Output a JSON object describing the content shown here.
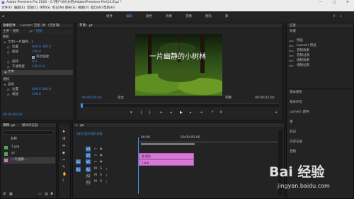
{
  "window": {
    "title": "Adobe Premiere Pro 2020 - C:\\用户\\XX\\文档\\Adobe\\Premiere Pro\\14.0\\yz *",
    "controls": [
      "—",
      "□",
      "✕"
    ]
  },
  "menu": [
    "文件(F)",
    "编辑(E)",
    "剪辑(C)",
    "序列(S)",
    "标记(M)",
    "图形(G)",
    "视图(V)",
    "窗口(W)",
    "帮助(H)"
  ],
  "workspace": {
    "tabs": [
      "组件",
      "编辑",
      "颜色",
      "效果",
      "音频",
      "图形",
      "库"
    ],
    "active": "编辑"
  },
  "effect_controls": {
    "tabs": [
      "效果控件",
      "Lumetri 范围",
      "源：(无剪辑)",
      "音频剪辑混合器"
    ],
    "clip_row": [
      "主要 * 图形",
      "yz * 图形"
    ],
    "sections": [
      {
        "label": "图形",
        "level": 0
      },
      {
        "label": "文本(一片幽静…)",
        "level": 1
      },
      {
        "label": "位置",
        "value": "640.0  360.0",
        "level": 2
      },
      {
        "label": "缩放",
        "value": "100.0",
        "level": 2
      },
      {
        "label": "",
        "checkbox": "等比缩放",
        "level": 2
      },
      {
        "label": "旋转",
        "value": "0.0",
        "level": 2
      },
      {
        "label": "不透明度",
        "value": "100.0 %",
        "level": 2
      },
      {
        "label": "文本",
        "level": 1
      },
      {
        "label": "视频",
        "level": 0
      },
      {
        "label": "运动",
        "level": 1
      },
      {
        "label": "位置",
        "value": "640.0  360.0",
        "level": 2
      },
      {
        "label": "缩放",
        "value": "100.0",
        "level": 2
      }
    ],
    "timecode": "00:00:00:00"
  },
  "program": {
    "tab": "节目：yz",
    "overlay_text": "一片幽静的小树林",
    "timecode_left": "00:00:00:00",
    "fit": "适合",
    "quality": "完整",
    "timecode_right": "00:00:03:00",
    "controls": [
      "marker-icon",
      "in-icon",
      "out-icon",
      "step-back-icon",
      "frame-back-icon",
      "play-icon",
      "frame-forward-icon",
      "step-forward-icon",
      "lift-icon",
      "extract-icon",
      "export-frame-icon"
    ]
  },
  "right_panel": {
    "sections": [
      "信息",
      "效果",
      "基本图形",
      "基本声音",
      "Lumetri 颜色",
      "库",
      "标记",
      "历史记录",
      "音频"
    ],
    "effects_items": [
      "预设",
      "Lumetri 预设",
      "音频效果",
      "音频过渡",
      "视频效果",
      "视频过渡"
    ]
  },
  "project": {
    "tabs": [
      "项目: yz",
      "媒体浏览器"
    ],
    "search_placeholder": "",
    "header": "名称",
    "items": [
      {
        "name": "1.jpg",
        "color": "#5aa55a"
      },
      {
        "name": "yz",
        "color": "#5aa55a"
      },
      {
        "name": "一片幽静…",
        "color": "#d07ad0"
      }
    ],
    "footer_icons": [
      "list-view-icon",
      "icon-view-icon",
      "new-bin-icon",
      "new-item-icon",
      "trash-icon"
    ]
  },
  "timeline": {
    "tab": "yz",
    "timecode": "00:00:00:00",
    "ruler": [
      "00:00",
      "00:00:05:00"
    ],
    "video_tracks": [
      "V3",
      "V2",
      "V1"
    ],
    "audio_tracks": [
      "A1",
      "A2",
      "A3"
    ],
    "source_patch": [
      "V1",
      "A1"
    ],
    "clips": [
      {
        "track": "V2",
        "label": "一片幽静的小树林",
        "short": "图 图形"
      },
      {
        "track": "V1",
        "label": "1.jpg",
        "short": "1.jpg"
      }
    ]
  },
  "watermark": {
    "brand": "Bai 经验",
    "url": "jingyan.baidu.com"
  },
  "colors": {
    "accent": "#3f8fe5",
    "clip_pink": "#d67ad6",
    "bg": "#1d1d1d"
  }
}
